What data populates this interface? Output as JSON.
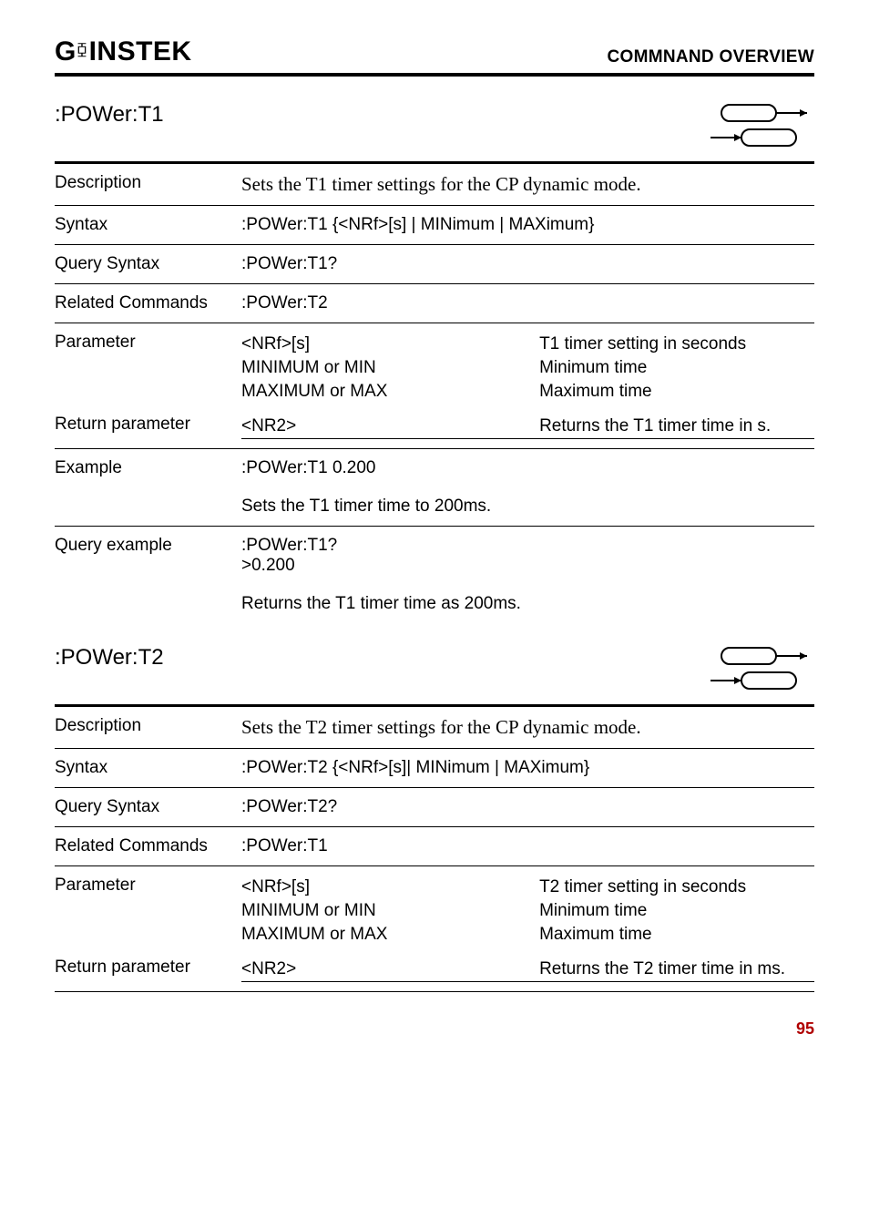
{
  "header": {
    "logo_left": "G",
    "logo_sup": "⧮",
    "logo_right": "INSTEK",
    "section": "COMMNAND OVERVIEW"
  },
  "cmd1": {
    "name": ":POWer:T1",
    "desc_label": "Description",
    "desc": "Sets the T1 timer settings for the CP dynamic mode.",
    "syntax_label": "Syntax",
    "syntax": ":POWer:T1 {<NRf>[s] | MINimum | MAXimum}",
    "query_label": "Query Syntax",
    "query": ":POWer:T1?",
    "related_label": "Related Commands",
    "related": ":POWer:T2",
    "param_label": "Parameter",
    "param_a1": "<NRf>[s]",
    "param_b1": "T1 timer setting in seconds",
    "param_a2": "MINIMUM or MIN",
    "param_b2": "Minimum time",
    "param_a3": "MAXIMUM or MAX",
    "param_b3": "Maximum time",
    "ret_label": "Return parameter",
    "ret_a": "<NR2>",
    "ret_b": "Returns the T1 timer time in s.",
    "ex_label": "Example",
    "ex_val": ":POWer:T1 0.200",
    "ex_note": "Sets the T1 timer time to 200ms.",
    "qex_label": "Query example",
    "qex_l1": ":POWer:T1?",
    "qex_l2": ">0.200",
    "qex_note": "Returns the T1 timer time as 200ms."
  },
  "cmd2": {
    "name": ":POWer:T2",
    "desc_label": "Description",
    "desc": "Sets the T2 timer settings for the CP dynamic mode.",
    "syntax_label": "Syntax",
    "syntax": ":POWer:T2 {<NRf>[s]| MINimum | MAXimum}",
    "query_label": "Query Syntax",
    "query": ":POWer:T2?",
    "related_label": "Related Commands",
    "related": ":POWer:T1",
    "param_label": "Parameter",
    "param_a1": "<NRf>[s]",
    "param_b1": "T2 timer setting in seconds",
    "param_a2": "MINIMUM or MIN",
    "param_b2": "Minimum time",
    "param_a3": "MAXIMUM or MAX",
    "param_b3": "Maximum time",
    "ret_label": "Return parameter",
    "ret_a": "<NR2>",
    "ret_b": "Returns the T2 timer time in ms."
  },
  "footer": {
    "page": "95"
  }
}
